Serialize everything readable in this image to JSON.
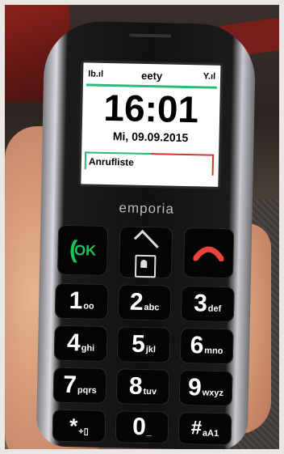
{
  "screen": {
    "status": {
      "battery_glyph": "Ib.ıl",
      "carrier": "eety",
      "signal_glyph": "Y.ıl"
    },
    "time": "16:01",
    "date": "Mi, 09.09.2015",
    "softkey_left": "Anrufliste"
  },
  "brand": "emporia",
  "keys": {
    "call": "OK",
    "k1": {
      "num": "1",
      "sub": "oo"
    },
    "k2": {
      "num": "2",
      "sub": "abc"
    },
    "k3": {
      "num": "3",
      "sub": "def"
    },
    "k4": {
      "num": "4",
      "sub": "ghi"
    },
    "k5": {
      "num": "5",
      "sub": "jkl"
    },
    "k6": {
      "num": "6",
      "sub": "mno"
    },
    "k7": {
      "num": "7",
      "sub": "pqrs"
    },
    "k8": {
      "num": "8",
      "sub": "tuv"
    },
    "k9": {
      "num": "9",
      "sub": "wxyz"
    },
    "star": {
      "num": "*",
      "sub": "+▯"
    },
    "k0": {
      "num": "0",
      "sub": "_"
    },
    "hash": {
      "num": "#",
      "sub": "aA1"
    }
  },
  "colors": {
    "accent_green": "#2fb978",
    "accent_red": "#d23a2c",
    "call_green": "#20c35a"
  }
}
